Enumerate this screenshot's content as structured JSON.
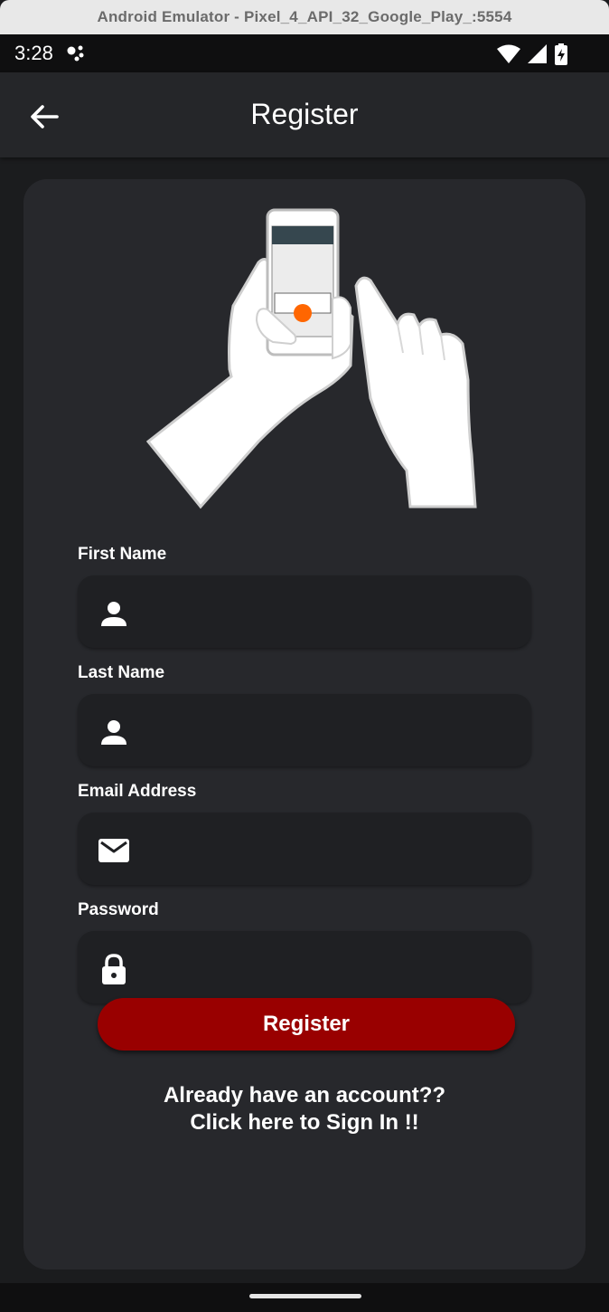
{
  "window": {
    "title": "Android Emulator - Pixel_4_API_32_Google_Play_:5554"
  },
  "status_bar": {
    "time": "3:28",
    "icons": [
      "assistant-dots-icon",
      "wifi-icon",
      "signal-icon",
      "battery-charging-icon"
    ]
  },
  "app_bar": {
    "title": "Register",
    "back_icon": "arrow-left-icon"
  },
  "illustration": {
    "name": "hands-holding-phone-illustration",
    "accent_color": "#ff6600"
  },
  "form": {
    "first_name": {
      "label": "First Name",
      "icon": "person-icon",
      "value": ""
    },
    "last_name": {
      "label": "Last Name",
      "icon": "person-icon",
      "value": ""
    },
    "email": {
      "label": "Email Address",
      "icon": "mail-icon",
      "value": ""
    },
    "password": {
      "label": "Password",
      "icon": "lock-icon",
      "value": ""
    }
  },
  "register_button": {
    "label": "Register",
    "color": "#990000"
  },
  "signin": {
    "line1": "Already have an account??",
    "line2": "Click here to Sign In !!"
  },
  "colors": {
    "background": "#1b1c1e",
    "card": "#27282c",
    "field": "#1f2023",
    "app_bar": "#252629"
  }
}
